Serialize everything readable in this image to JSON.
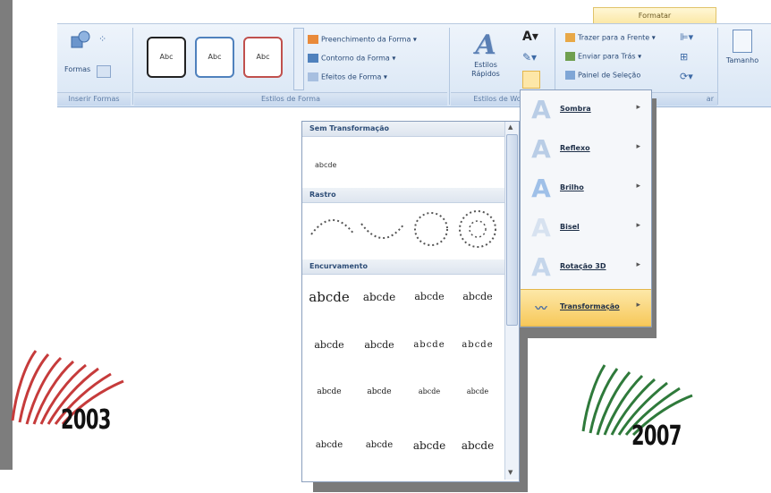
{
  "ribbon": {
    "context_tab": "Formatar",
    "groups": {
      "insert_shapes": "Inserir Formas",
      "shape_styles": "Estilos de Forma",
      "wordart_styles": "Estilos de Wo",
      "arrange": "ar"
    },
    "formas_label": "Formas",
    "style_samples": [
      "Abc",
      "Abc",
      "Abc"
    ],
    "shape_fill": "Preenchimento da Forma",
    "shape_outline": "Contorno da Forma",
    "shape_effects": "Efeitos de Forma",
    "wordart_quick": "Estilos\nRápidos",
    "bring_forward": "Trazer para a Frente",
    "send_backward": "Enviar para Trás",
    "selection_pane": "Painel de Seleção",
    "size": "Tamanho"
  },
  "transform_panel": {
    "sections": [
      {
        "title": "Sem Transformação"
      },
      {
        "title": "Rastro"
      },
      {
        "title": "Encurvamento"
      }
    ],
    "plain_sample": "abcde",
    "warp_samples": [
      "abcde",
      "abcde",
      "abcde",
      "abcde",
      "abcde",
      "abcde",
      "abcde",
      "abcde",
      "abcde",
      "abcde",
      "abcde",
      "abcde",
      "abcde",
      "abcde",
      "abcde",
      "abcde"
    ]
  },
  "effects_menu": {
    "items": [
      {
        "label": "Sombra"
      },
      {
        "label": "Reflexo"
      },
      {
        "label": "Brilho"
      },
      {
        "label": "Bisel"
      },
      {
        "label": "Rotação 3D"
      },
      {
        "label": "Transformação",
        "active": true
      }
    ]
  },
  "logos": {
    "left_year": "2003",
    "right_year": "2007"
  },
  "colors": {
    "ribbon": "#d9e6f5",
    "context_tab": "#fbe7a4",
    "active_item": "#f7c85a",
    "logo_2003": "#c63b3b",
    "logo_2007": "#2f7a3b"
  }
}
